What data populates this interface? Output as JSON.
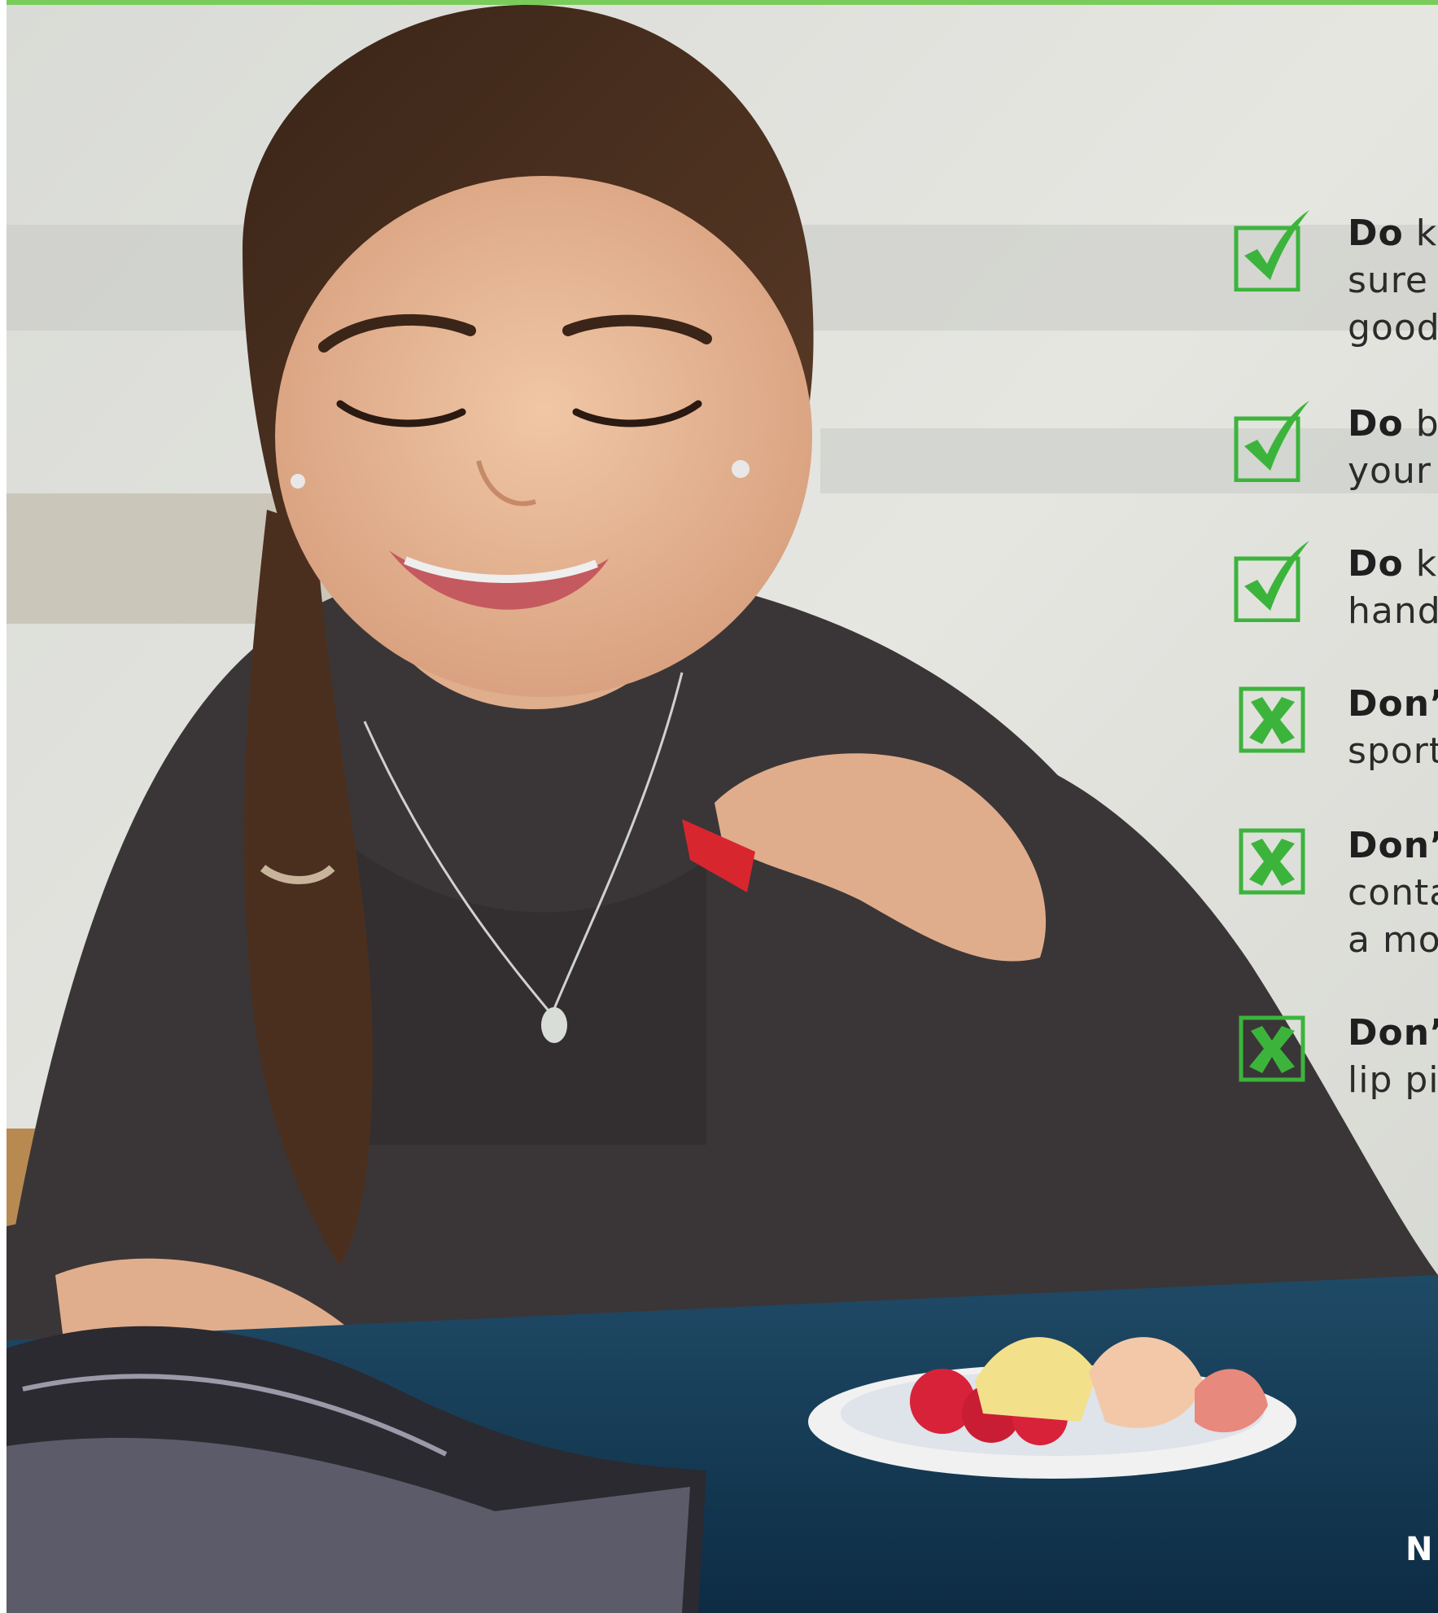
{
  "colors": {
    "accent_green": "#3cb43c",
    "top_bar": "#7acc5a",
    "text": "#2b2b2b"
  },
  "tips": [
    {
      "icon": "check-icon",
      "keyword": "Do",
      "lines": [
        " k",
        "sure",
        "good"
      ]
    },
    {
      "icon": "check-icon",
      "keyword": "Do",
      "lines": [
        " b",
        "your"
      ]
    },
    {
      "icon": "check-icon",
      "keyword": "Do",
      "lines": [
        " k",
        "hand"
      ]
    },
    {
      "icon": "x-icon",
      "keyword": "Don’",
      "lines": [
        "",
        "sport"
      ]
    },
    {
      "icon": "x-icon",
      "keyword": "Don’",
      "lines": [
        "",
        "conta",
        "a mo"
      ]
    },
    {
      "icon": "x-icon",
      "keyword": "Don’",
      "lines": [
        "",
        "lip pi"
      ]
    }
  ],
  "corner_letter": "N"
}
